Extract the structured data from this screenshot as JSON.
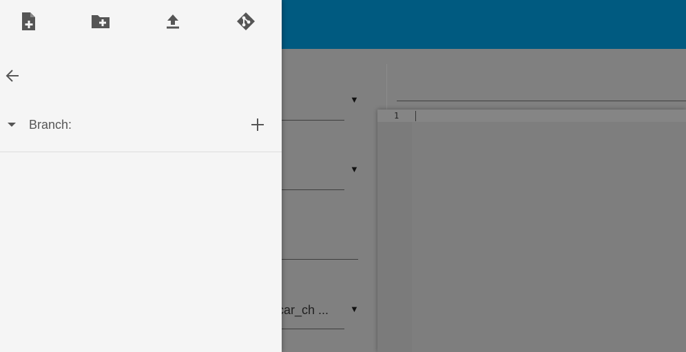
{
  "background": {
    "fields": [
      {
        "value": ""
      },
      {
        "value": ""
      },
      {
        "value": ""
      },
      {
        "value": "it_car_ch ..."
      }
    ],
    "editor": {
      "line_number": "1"
    }
  },
  "drawer": {
    "toolbar": [
      {
        "icon": "new-file-icon"
      },
      {
        "icon": "new-folder-icon"
      },
      {
        "icon": "upload-icon"
      },
      {
        "icon": "git-icon"
      }
    ],
    "back_icon": "arrow-left-icon",
    "branch": {
      "label": "Branch:",
      "add_icon": "plus-icon",
      "toggle_icon": "caret-down-icon"
    }
  },
  "colors": {
    "app_bar": "#005a80",
    "drawer_bg": "#f5f5f5",
    "icon": "#555555",
    "overlay": "#808080"
  }
}
